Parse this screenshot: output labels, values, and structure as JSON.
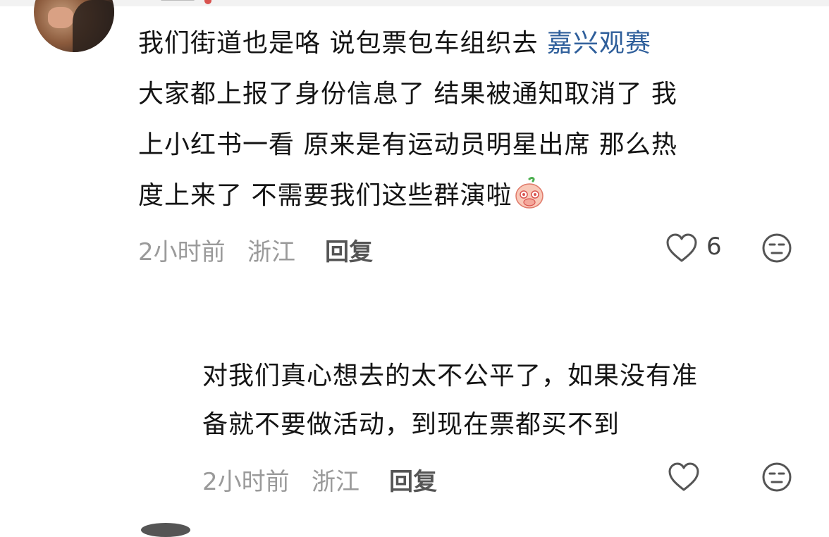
{
  "comments": [
    {
      "segments": [
        {
          "text": "我们街道也是咯 说包票包车组织去 ",
          "link": false
        },
        {
          "text": "嘉兴观赛",
          "link": true
        }
      ],
      "lines": [
        "大家都上报了身份信息了 结果被通知取消了 我",
        "上小红书一看 原来是有运动员明星出席 那么热",
        "度上来了 不需要我们这些群演啦"
      ],
      "sticker": "shy-peach-emoji-icon",
      "time": "2小时前",
      "location": "浙江",
      "reply_label": "回复",
      "likes": "6"
    },
    {
      "lines": [
        "对我们真心想去的太不公平了，如果没有准",
        "备就不要做活动，到现在票都买不到"
      ],
      "time": "2小时前",
      "location": "浙江",
      "reply_label": "回复",
      "likes": ""
    }
  ],
  "colors": {
    "link": "#2f5f9b",
    "meta": "#9a9a9a",
    "text": "#141414"
  }
}
